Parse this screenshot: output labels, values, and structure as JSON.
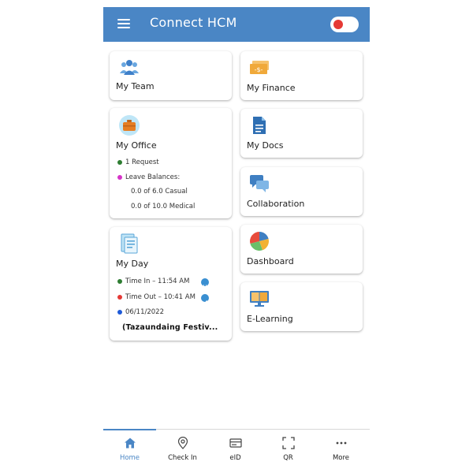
{
  "app": {
    "title": "Connect HCM"
  },
  "cards": {
    "my_team": {
      "title": "My Team",
      "icon": "team-icon"
    },
    "my_finance": {
      "title": "My Finance",
      "icon": "money-icon"
    },
    "my_office": {
      "title": "My Office",
      "icon": "briefcase-icon",
      "request": "1 Request",
      "leave_label": "Leave Balances:",
      "leave_casual": "0.0 of 6.0 Casual",
      "leave_medical": "0.0 of 10.0 Medical"
    },
    "my_docs": {
      "title": "My Docs",
      "icon": "document-icon"
    },
    "collaboration": {
      "title": "Collaboration",
      "icon": "chat-icon"
    },
    "my_day": {
      "title": "My Day",
      "icon": "newspaper-icon",
      "time_in": "Time In – 11:54 AM",
      "time_out": "Time Out – 10:41 AM",
      "date": "06/11/2022",
      "holiday": "(Tazaundaing Festiv..."
    },
    "dashboard": {
      "title": "Dashboard",
      "icon": "pie-chart-icon"
    },
    "elearning": {
      "title": "E-Learning",
      "icon": "book-icon"
    }
  },
  "nav": [
    {
      "label": "Home",
      "icon": "home-icon",
      "active": true
    },
    {
      "label": "Check In",
      "icon": "location-pin-icon",
      "active": false
    },
    {
      "label": "eID",
      "icon": "id-card-icon",
      "active": false
    },
    {
      "label": "QR",
      "icon": "qr-scan-icon",
      "active": false
    },
    {
      "label": "More",
      "icon": "more-dots-icon",
      "active": false
    }
  ],
  "colors": {
    "primary": "#4a86c5",
    "toggle_dot": "#e53935",
    "green": "#2e7d32",
    "magenta": "#d633c8",
    "red": "#e53935",
    "blue": "#1e5ad8"
  }
}
